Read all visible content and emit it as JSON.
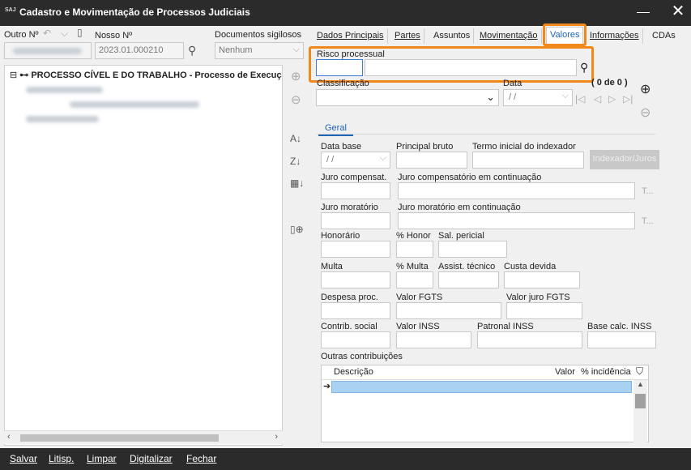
{
  "window": {
    "title": "Cadastro e Movimentação de Processos Judiciais",
    "logo": "SAJ"
  },
  "header": {
    "outro_label": "Outro Nº",
    "nosso_label": "Nosso Nº",
    "nosso_value": "2023.01.000210",
    "sigilosos_label": "Documentos sigilosos",
    "sigilosos_value": "Nenhum"
  },
  "tree": {
    "root_label": "PROCESSO CÍVEL E DO TRABALHO - Processo de Execução"
  },
  "tabs": [
    {
      "label": "Dados Principais"
    },
    {
      "label": "Partes"
    },
    {
      "label": "Assuntos"
    },
    {
      "label": "Movimentação"
    },
    {
      "label": "Valores"
    },
    {
      "label": "Informações"
    },
    {
      "label": "CDAs"
    }
  ],
  "valores": {
    "risco_label": "Risco processual",
    "classificacao_label": "Classificação",
    "data_label": "Data",
    "data_value": " /  /",
    "counter": "( 0 de 0 )",
    "geral_tab": "Geral",
    "fields": {
      "data_base": "Data base",
      "data_base_value": " /  /",
      "principal_bruto": "Principal bruto",
      "termo_inicial": "Termo inicial do indexador",
      "indexador_btn": "Indexador/Juros",
      "juro_compensat": "Juro compensat.",
      "juro_comp_cont": "Juro compensatório em continuação",
      "juro_moratorio": "Juro moratório",
      "juro_mor_cont": "Juro moratório em continuação",
      "t_ellipsis": "T...",
      "honorario": "Honorário",
      "pct_honor": "% Honor",
      "sal_pericial": "Sal. pericial",
      "multa": "Multa",
      "pct_multa": "% Multa",
      "assist_tecnico": "Assist. técnico",
      "custa_devida": "Custa devida",
      "despesa_proc": "Despesa proc.",
      "valor_fgts": "Valor FGTS",
      "valor_juro_fgts": "Valor juro FGTS",
      "contrib_social": "Contrib. social",
      "valor_inss": "Valor INSS",
      "patronal_inss": "Patronal INSS",
      "base_calc_inss": "Base calc. INSS",
      "outras_contrib": "Outras contribuições"
    },
    "grid": {
      "col_descricao": "Descrição",
      "col_valor": "Valor",
      "col_incidencia": "% incidência"
    }
  },
  "bottom": {
    "salvar": "Salvar",
    "litisp": "Litisp.",
    "limpar": "Limpar",
    "digitalizar": "Digitalizar",
    "fechar": "Fechar"
  },
  "colors": {
    "highlight": "#f0881a",
    "accent": "#1f63b3",
    "grid_selected": "#a8d2f0"
  }
}
